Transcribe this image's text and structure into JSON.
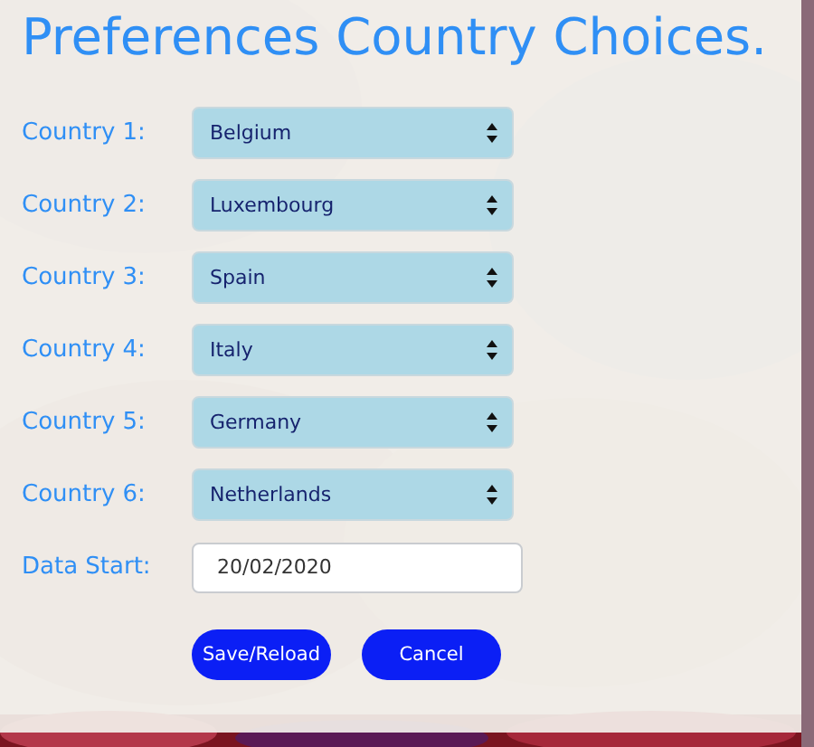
{
  "title": "Preferences Country Choices.",
  "countries": [
    {
      "label": "Country 1:",
      "value": "Belgium"
    },
    {
      "label": "Country 2:",
      "value": "Luxembourg"
    },
    {
      "label": "Country 3:",
      "value": "Spain"
    },
    {
      "label": "Country 4:",
      "value": "Italy"
    },
    {
      "label": "Country 5:",
      "value": "Germany"
    },
    {
      "label": "Country 6:",
      "value": "Netherlands"
    }
  ],
  "date_start": {
    "label": "Data Start:",
    "value": "20/02/2020"
  },
  "buttons": [
    "Save/Reload",
    "Cancel"
  ]
}
